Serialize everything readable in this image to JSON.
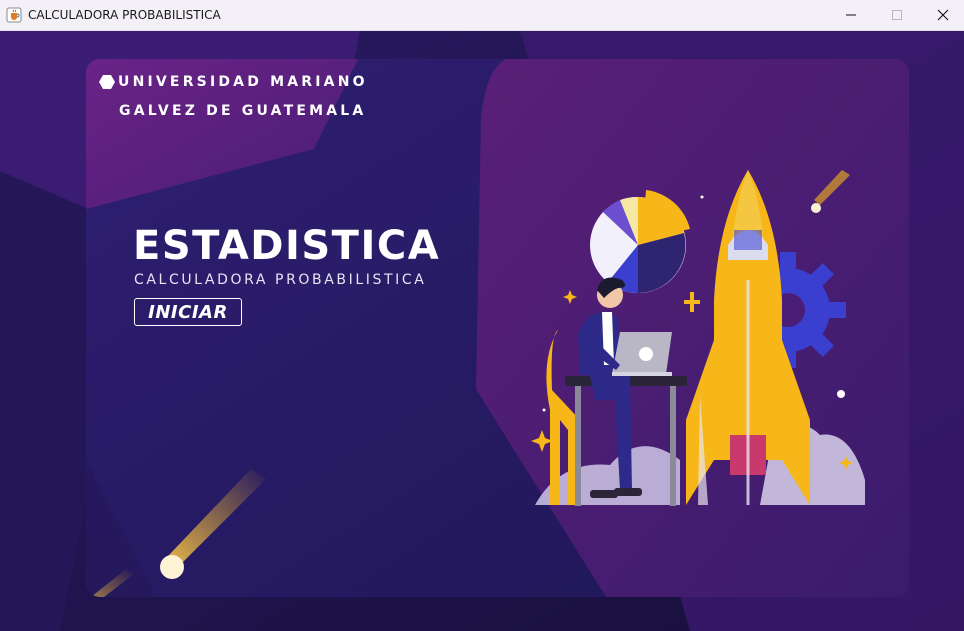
{
  "window": {
    "title": "CALCULADORA PROBABILISTICA",
    "app_icon": "java-cup-icon",
    "controls": {
      "minimize": "minimize-icon",
      "maximize": "maximize-icon",
      "close": "close-icon"
    }
  },
  "brand": {
    "logo_icon": "hexagon-logo-icon",
    "line1": "UNIVERSIDAD MARIANO",
    "line2": "GALVEZ DE GUATEMALA"
  },
  "hero": {
    "title": "ESTADISTICA",
    "subtitle": "CALCULADORA PROBABILISTICA",
    "start_label": "INICIAR"
  },
  "illustration": {
    "icons": [
      "pie-chart-icon",
      "rocket-icon",
      "gear-icon",
      "person-with-laptop-icon",
      "sparkle-icon",
      "meteor-icon"
    ]
  },
  "colors": {
    "background": "#1d1447",
    "card_purple": "#5b1f78",
    "card_indigo": "#2b1b6b",
    "accent_yellow": "#f7b719",
    "gear_blue": "#3b3fd0"
  }
}
